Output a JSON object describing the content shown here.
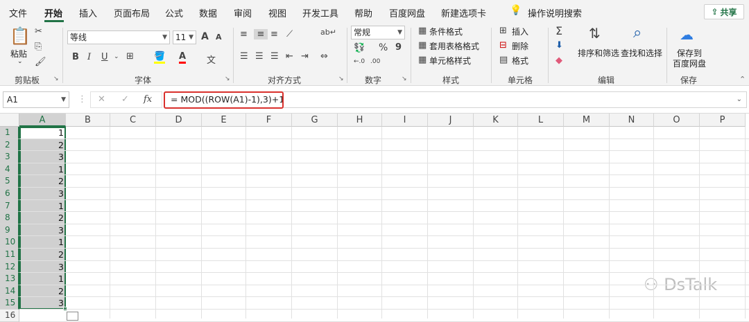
{
  "menu": {
    "tabs": [
      "文件",
      "开始",
      "插入",
      "页面布局",
      "公式",
      "数据",
      "审阅",
      "视图",
      "开发工具",
      "帮助",
      "百度网盘",
      "新建选项卡"
    ],
    "active_tab": "开始",
    "search_label": "操作说明搜索",
    "share_label": "共享"
  },
  "ribbon": {
    "clipboard": {
      "paste": "粘贴",
      "label": "剪贴板"
    },
    "font": {
      "name": "等线",
      "size": "11",
      "label": "字体",
      "grow": "A",
      "shrink": "A",
      "bold": "B",
      "italic": "I",
      "underline": "U",
      "font_color": "A",
      "phonetic": "文"
    },
    "alignment": {
      "label": "对齐方式"
    },
    "number": {
      "format": "常规",
      "percent": "%",
      "comma": "9",
      "label": "数字"
    },
    "styles": {
      "conditional": "条件格式",
      "table": "套用表格格式",
      "cell": "单元格样式",
      "label": "样式"
    },
    "cells": {
      "insert": "插入",
      "delete": "删除",
      "format": "格式",
      "label": "单元格"
    },
    "editing": {
      "sort": "排序和筛选",
      "find": "查找和选择",
      "label": "编辑"
    },
    "save": {
      "line1": "保存到",
      "line2": "百度网盘",
      "label": "保存"
    }
  },
  "formula_bar": {
    "name_box": "A1",
    "fx": "fx",
    "formula": "= MOD((ROW(A1)-1),3)+1"
  },
  "grid": {
    "columns": [
      "A",
      "B",
      "C",
      "D",
      "E",
      "F",
      "G",
      "H",
      "I",
      "J",
      "K",
      "L",
      "M",
      "N",
      "O",
      "P"
    ],
    "rows": [
      "1",
      "2",
      "3",
      "4",
      "5",
      "6",
      "7",
      "8",
      "9",
      "10",
      "11",
      "12",
      "13",
      "14",
      "15",
      "16"
    ],
    "column_a_values": [
      "1",
      "2",
      "3",
      "1",
      "2",
      "3",
      "1",
      "2",
      "3",
      "1",
      "2",
      "3",
      "1",
      "2",
      "3"
    ]
  },
  "watermark": "DsTalk",
  "colors": {
    "accent": "#217346",
    "highlight": "#d9302c"
  }
}
